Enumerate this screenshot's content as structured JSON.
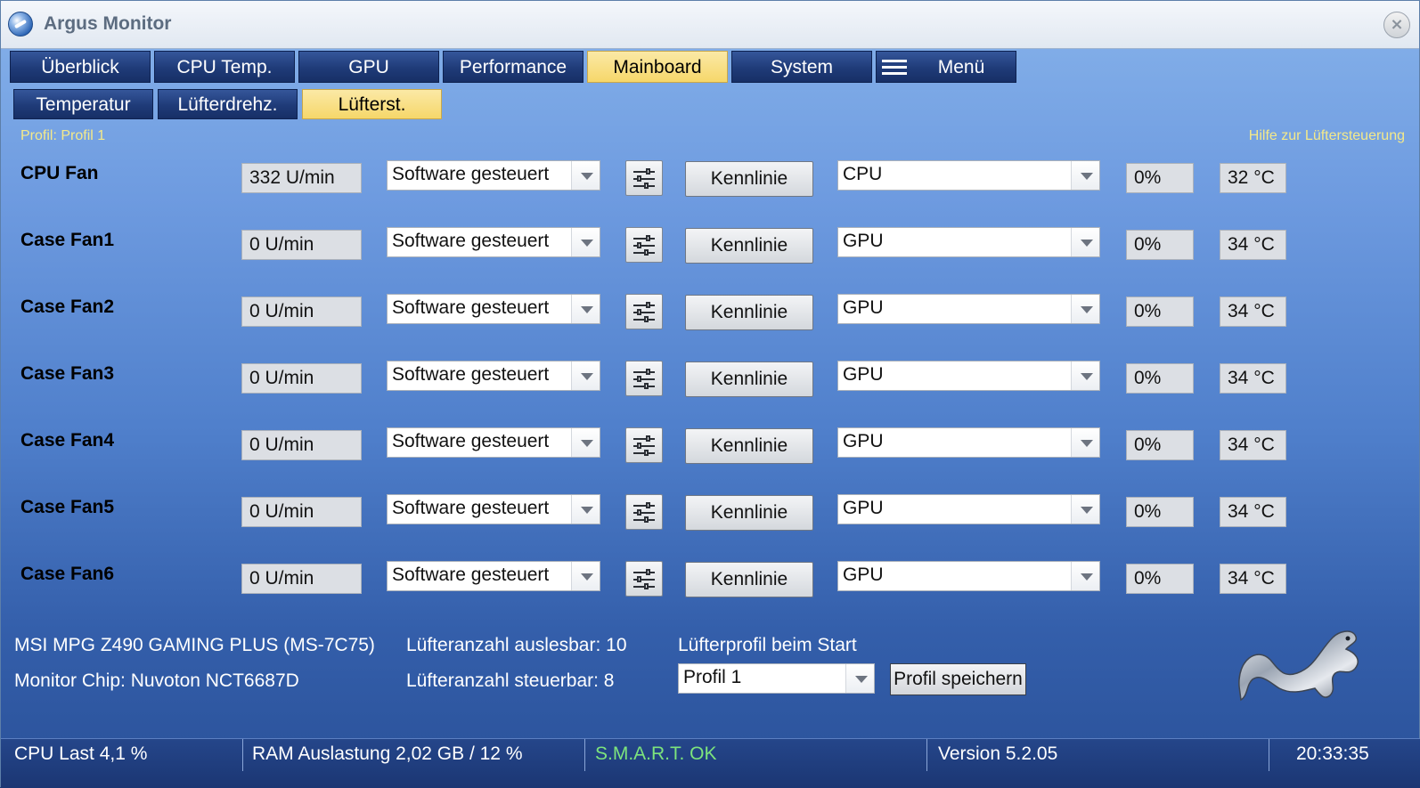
{
  "window": {
    "title": "Argus Monitor"
  },
  "tabs": [
    {
      "label": "Überblick"
    },
    {
      "label": "CPU Temp."
    },
    {
      "label": "GPU"
    },
    {
      "label": "Performance"
    },
    {
      "label": "Mainboard"
    },
    {
      "label": "System"
    },
    {
      "label": "Menü"
    }
  ],
  "subtabs": [
    {
      "label": "Temperatur"
    },
    {
      "label": "Lüfterdrehz."
    },
    {
      "label": "Lüfterst."
    }
  ],
  "profile_label": "Profil: Profil 1",
  "help_link": "Hilfe zur Lüftersteuerung",
  "fans": [
    {
      "name": "CPU Fan",
      "speed": "332 U/min",
      "mode": "Software gesteuert",
      "curve_label": "Kennlinie",
      "source": "CPU",
      "percent": "0%",
      "temp": "32 °C"
    },
    {
      "name": "Case Fan1",
      "speed": "0 U/min",
      "mode": "Software gesteuert",
      "curve_label": "Kennlinie",
      "source": "GPU",
      "percent": "0%",
      "temp": "34 °C"
    },
    {
      "name": "Case Fan2",
      "speed": "0 U/min",
      "mode": "Software gesteuert",
      "curve_label": "Kennlinie",
      "source": "GPU",
      "percent": "0%",
      "temp": "34 °C"
    },
    {
      "name": "Case Fan3",
      "speed": "0 U/min",
      "mode": "Software gesteuert",
      "curve_label": "Kennlinie",
      "source": "GPU",
      "percent": "0%",
      "temp": "34 °C"
    },
    {
      "name": "Case Fan4",
      "speed": "0 U/min",
      "mode": "Software gesteuert",
      "curve_label": "Kennlinie",
      "source": "GPU",
      "percent": "0%",
      "temp": "34 °C"
    },
    {
      "name": "Case Fan5",
      "speed": "0 U/min",
      "mode": "Software gesteuert",
      "curve_label": "Kennlinie",
      "source": "GPU",
      "percent": "0%",
      "temp": "34 °C"
    },
    {
      "name": "Case Fan6",
      "speed": "0 U/min",
      "mode": "Software gesteuert",
      "curve_label": "Kennlinie",
      "source": "GPU",
      "percent": "0%",
      "temp": "34 °C"
    }
  ],
  "info": {
    "board": "MSI MPG Z490 GAMING PLUS (MS-7C75)",
    "chip": "Monitor Chip: Nuvoton NCT6687D",
    "fans_readable": "Lüfteranzahl auslesbar: 10",
    "fans_controllable": "Lüfteranzahl steuerbar: 8",
    "startup_profile_label": "Lüfterprofil beim Start",
    "startup_profile_value": "Profil 1",
    "save_button": "Profil speichern"
  },
  "status": {
    "cpu_load": "CPU Last 4,1 %",
    "ram": "RAM Auslastung 2,02 GB / 12 %",
    "smart": "S.M.A.R.T. OK",
    "version": "Version 5.2.05",
    "time": "20:33:35"
  },
  "colors": {
    "accent_tab": "#f6d76a",
    "smart_ok": "#7de47d",
    "profile_text": "#f4e98a"
  }
}
